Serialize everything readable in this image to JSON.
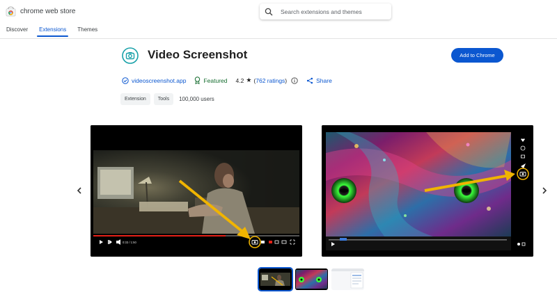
{
  "header": {
    "brand": "chrome web store",
    "search_placeholder": "Search extensions and themes"
  },
  "nav": [
    {
      "label": "Discover",
      "active": false
    },
    {
      "label": "Extensions",
      "active": true
    },
    {
      "label": "Themes",
      "active": false
    }
  ],
  "extension": {
    "title": "Video Screenshot",
    "add_button": "Add to Chrome",
    "website": "videoscreenshot.app",
    "featured": "Featured",
    "rating": "4.2",
    "ratings_count": "762 ratings",
    "share": "Share",
    "chips": [
      "Extension",
      "Tools"
    ],
    "users": "100,000 users"
  },
  "screenshots": {
    "slide1": {
      "time": "0:33 / 1:50"
    }
  },
  "colors": {
    "accent": "#0b57d0",
    "featured_green": "#146c2e",
    "highlight_yellow": "#f0b400",
    "progress_red": "#e62117"
  }
}
